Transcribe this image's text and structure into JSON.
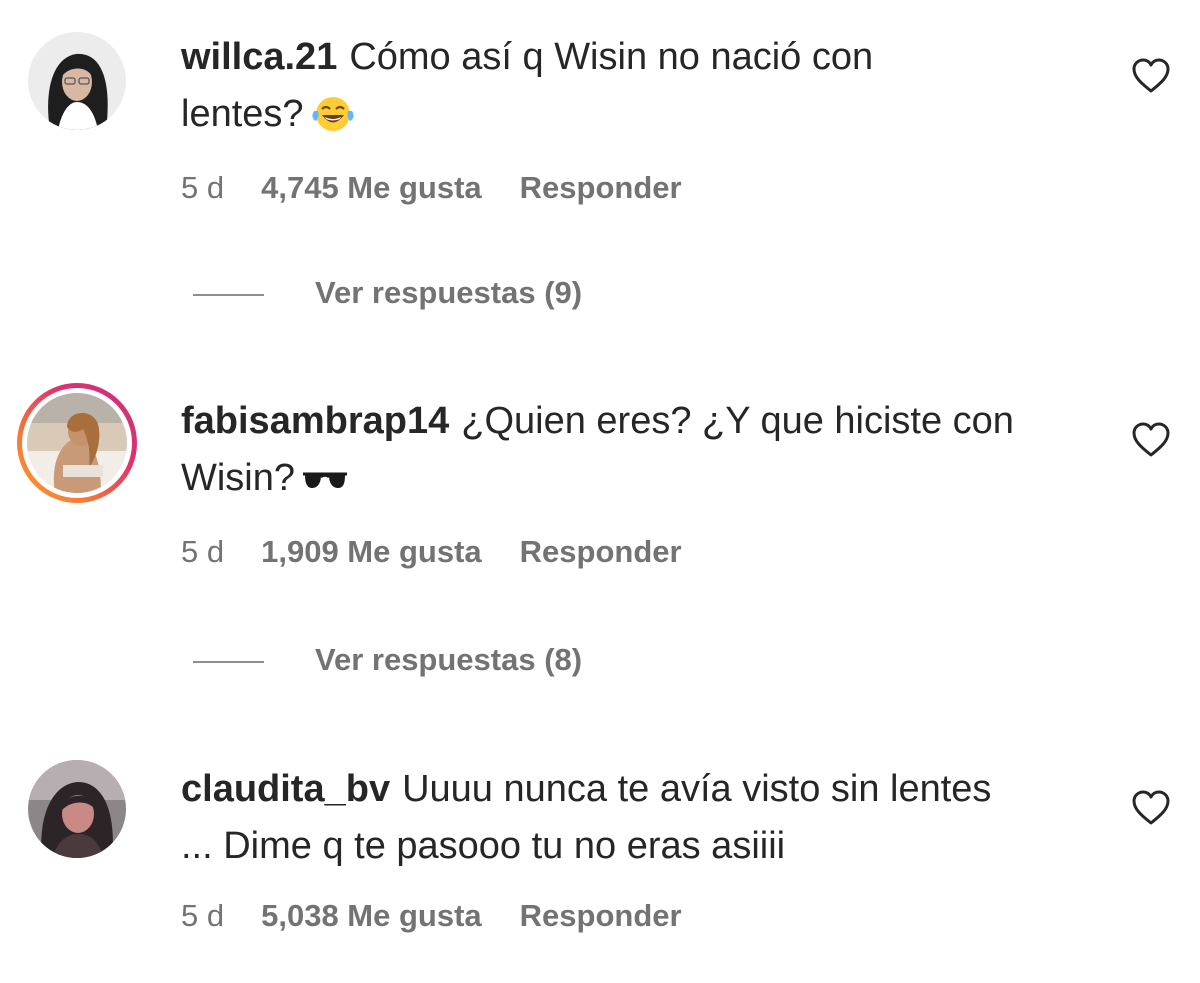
{
  "comments": [
    {
      "username": "willca.21",
      "text_line1": "Cómo así q Wisin no nació con",
      "text_line2": "lentes?",
      "emoji": "laughing-tears-emoji",
      "age": "5 d",
      "likes": "4,745 Me gusta",
      "reply_label": "Responder",
      "view_replies": "Ver respuestas (9)"
    },
    {
      "username": "fabisambrap14",
      "text_line1": "¿Quien eres? ¿Y que hiciste con",
      "text_line2": "Wisin?",
      "emoji": "sunglasses-emoji",
      "age": "5 d",
      "likes": "1,909 Me gusta",
      "reply_label": "Responder",
      "view_replies": "Ver respuestas (8)"
    },
    {
      "username": "claudita_bv",
      "text_line1": "Uuuu nunca te avía visto sin lentes",
      "text_line2": "... Dime q te pasooo tu no eras asiiii",
      "age": "5 d",
      "likes": "5,038 Me gusta",
      "reply_label": "Responder"
    }
  ],
  "icons": {
    "like": "heart-outline-icon"
  },
  "colors": {
    "text": "#262626",
    "secondary": "#737373",
    "story_ring": "#e1306c"
  }
}
